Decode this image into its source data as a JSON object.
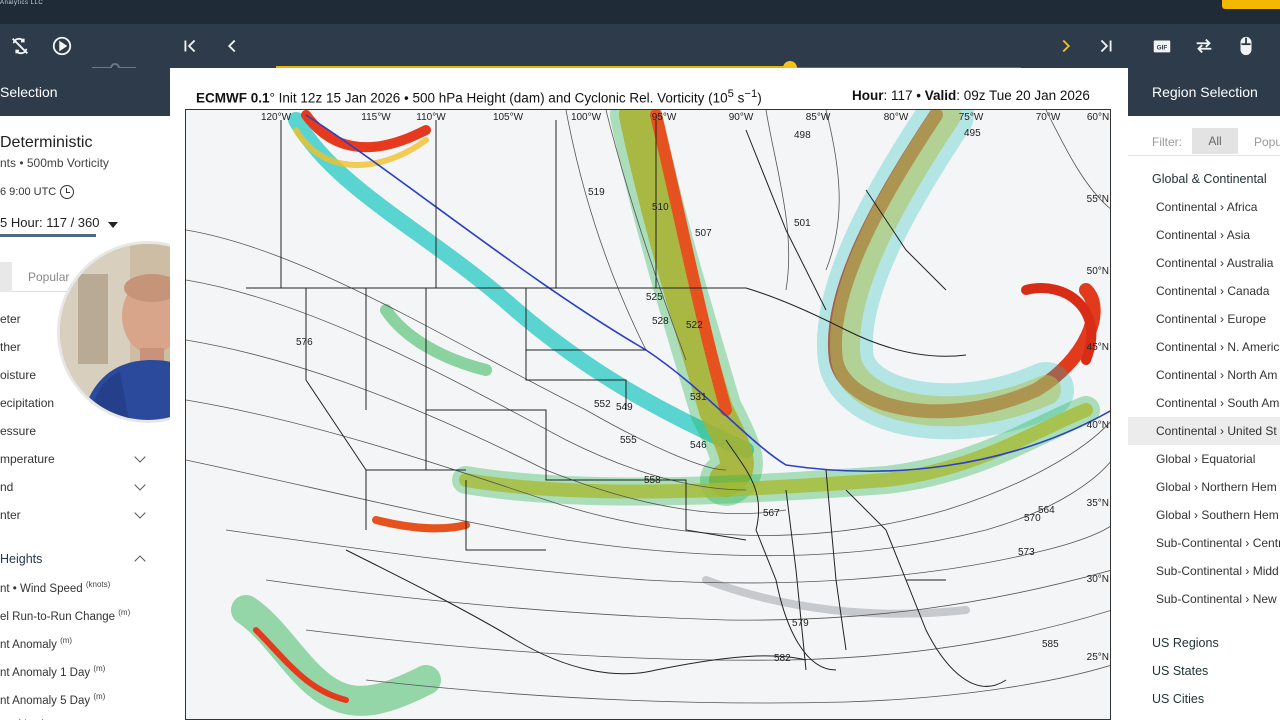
{
  "brand": "Analytics LLC",
  "toolbar": {
    "buttons": [
      "loop-off-icon",
      "play-icon",
      "first-frame-icon",
      "prev-frame-icon",
      "next-frame-icon",
      "last-frame-icon",
      "gif-icon",
      "compare-icon",
      "mouse-icon"
    ],
    "timeline_progress": 0.69,
    "accent": "#f3c21a"
  },
  "left": {
    "header": "Selection",
    "model_name": "Deterministic",
    "model_sub": "nts • 500mb Vorticity",
    "model_time": "6 9:00 UTC",
    "hour_label": "5  Hour: 117 / 360",
    "tab_popular": "Popular",
    "categories": [
      {
        "label": "eter"
      },
      {
        "label": "ther"
      },
      {
        "label": "oisture"
      },
      {
        "label": "ecipitation"
      },
      {
        "label": "essure"
      },
      {
        "label": "mperature"
      },
      {
        "label": "nd"
      },
      {
        "label": "nter"
      },
      {
        "label": "Heights"
      }
    ],
    "sub_items": [
      {
        "label": "nt • Wind Speed",
        "unit": "(knots)"
      },
      {
        "label": "el Run-to-Run Change",
        "unit": "(m)"
      },
      {
        "label": "nt Anomaly",
        "unit": "(m)"
      },
      {
        "label": "nt Anomaly 1 Day",
        "unit": "(m)"
      },
      {
        "label": "nt Anomaly 5 Day",
        "unit": "(m)"
      },
      {
        "label": "aly",
        "unit": "(sigma)"
      }
    ]
  },
  "map": {
    "title_left": "ECMWF 0.1° Init 12z 15 Jan 2026 • 500 hPa Height (dam) and Cyclonic Rel. Vorticity (10⁵ s⁻¹)",
    "title_model": "ECMWF 0.1",
    "title_rest": "° Init 12z 15 Jan 2026 • 500 hPa Height (dam) and Cyclonic Rel. Vorticity (10",
    "title_exp": "5",
    "title_unit": " s",
    "title_unit_exp": "−1",
    "title_close": ")",
    "hour_label": "Hour",
    "hour_value": ": 117 • ",
    "valid_label": "Valid",
    "valid_value": ": 09z Tue 20 Jan 2026",
    "lon_labels": [
      "120°W",
      "115°W",
      "110°W",
      "105°W",
      "100°W",
      "95°W",
      "90°W",
      "85°W",
      "80°W",
      "75°W",
      "70°W",
      "60°N"
    ],
    "lat_labels": [
      "55°N",
      "50°N",
      "45°N",
      "40°N",
      "35°N",
      "30°N",
      "25°N"
    ],
    "contour_labels": [
      "576",
      "519",
      "510",
      "507",
      "498",
      "501",
      "495",
      "525",
      "528",
      "522",
      "531",
      "552",
      "549",
      "555",
      "546",
      "558",
      "567",
      "564",
      "570",
      "573",
      "579",
      "582",
      "585"
    ]
  },
  "right": {
    "header": "Region Selection",
    "filter_label": "Filter:",
    "filter_all": "All",
    "filter_popular": "Popu",
    "group_global": "Global & Continental",
    "items": [
      "Continental › Africa",
      "Continental › Asia",
      "Continental › Australia",
      "Continental › Canada",
      "Continental › Europe",
      "Continental › N. Americ",
      "Continental › North Am",
      "Continental › South Am",
      "Continental › United St",
      "Global › Equatorial",
      "Global › Northern Hem",
      "Global › Southern Hem",
      "Sub-Continental › Centr",
      "Sub-Continental › Midd",
      "Sub-Continental › New"
    ],
    "selected_index": 8,
    "groups_bottom": [
      "US Regions",
      "US States",
      "US Cities"
    ]
  }
}
